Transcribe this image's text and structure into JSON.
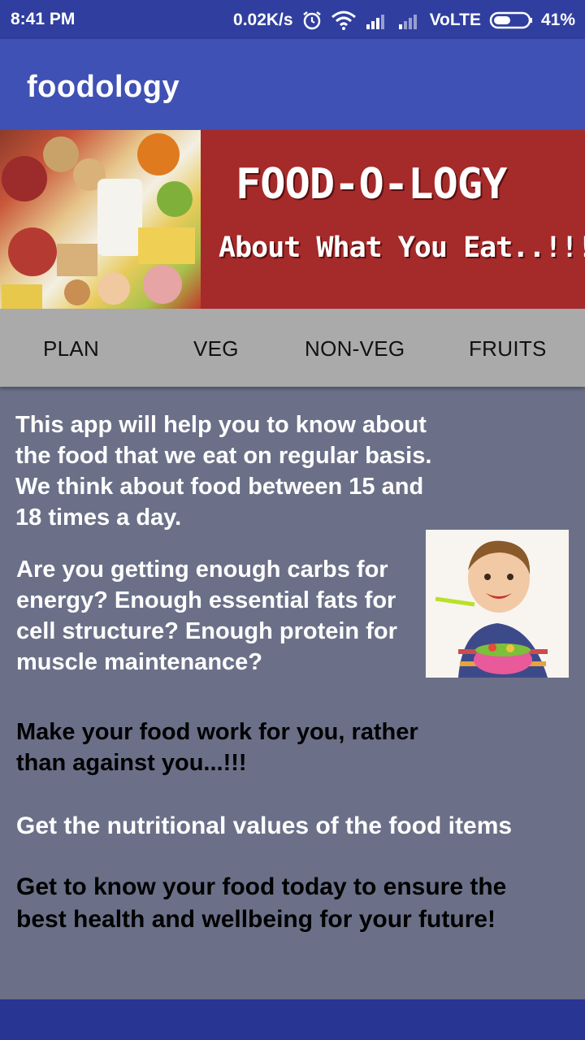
{
  "status": {
    "time": "8:41 PM",
    "net_speed": "0.02K/s",
    "carrier": "VoLTE",
    "battery": "41%",
    "icons": [
      "alarm-icon",
      "wifi-icon",
      "signal-icon",
      "signal-icon",
      "battery-icon"
    ]
  },
  "app_bar": {
    "title": "foodology"
  },
  "banner": {
    "title": "FOOD-O-LOGY",
    "subtitle": "About What You Eat..!!!"
  },
  "tabs": [
    "PLAN",
    "VEG",
    "NON-VEG",
    "FRUITS"
  ],
  "content": {
    "intro": "This app will help you to know about the food that we eat on regular basis. We think about food between 15 and 18 times a day.",
    "questions": "Are you getting enough carbs for energy? Enough essential fats for cell structure? Enough protein for muscle maintenance?",
    "tagline": "Make your food work for you, rather than against you...!!!",
    "nutrition": "Get the nutritional values of the food items",
    "closing": "Get to know your food today to ensure the best health and wellbeing for your future!"
  },
  "colors": {
    "status_bar": "#303f9f",
    "app_bar": "#3f51b5",
    "banner_red": "#a52a2a",
    "tab_bar": "#aaaaaa",
    "content_bg": "#6b7088",
    "bottom_bar": "#283593"
  }
}
